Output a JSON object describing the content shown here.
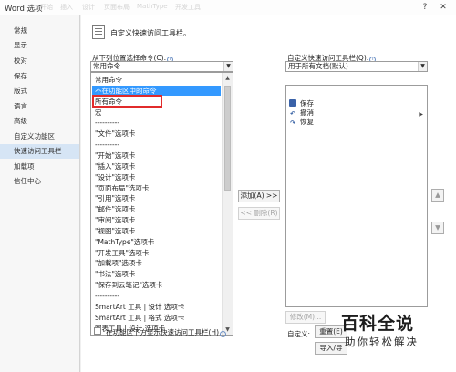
{
  "window": {
    "title": "Word 选项",
    "ghost_tabs": [
      "开始",
      "插入",
      "设计",
      "页面布局",
      "MathType",
      "开发工具"
    ],
    "help_icon": "question-icon",
    "close_icon": "close-icon"
  },
  "sidebar": {
    "items": [
      {
        "label": "常规"
      },
      {
        "label": "显示"
      },
      {
        "label": "校对"
      },
      {
        "label": "保存"
      },
      {
        "label": "版式"
      },
      {
        "label": "语言"
      },
      {
        "label": "高级"
      },
      {
        "label": "自定义功能区"
      },
      {
        "label": "快速访问工具栏",
        "active": true
      },
      {
        "label": "加载项"
      },
      {
        "label": "信任中心"
      }
    ]
  },
  "header": {
    "icon": "customize-toolbar-icon",
    "text": "自定义快速访问工具栏。"
  },
  "left": {
    "choose_label": "从下列位置选择命令(C):",
    "choose_value": "常用命令",
    "list_items": [
      "常用命令",
      "不在功能区中的命令",
      "所有命令",
      "宏",
      "----------",
      "\"文件\"选项卡",
      "----------",
      "\"开始\"选项卡",
      "\"插入\"选项卡",
      "\"设计\"选项卡",
      "\"页面布局\"选项卡",
      "\"引用\"选项卡",
      "\"邮件\"选项卡",
      "\"审阅\"选项卡",
      "\"视图\"选项卡",
      "\"MathType\"选项卡",
      "\"开发工具\"选项卡",
      "\"加载项\"选项卡",
      "\"书法\"选项卡",
      "\"保存到云笔记\"选项卡",
      "----------",
      "SmartArt 工具 | 设计 选项卡",
      "SmartArt 工具 | 格式 选项卡",
      "图表工具 | 设计 选项卡"
    ],
    "selected_index": 1,
    "show_below_label": "在功能区下方显示快速访问工具栏(H)"
  },
  "middle": {
    "add_label": "添加(A) >>",
    "remove_label": "<< 删除(R)"
  },
  "right": {
    "customize_label": "自定义快速访问工具栏(Q):",
    "customize_value": "用于所有文档(默认)",
    "qat_items": [
      {
        "label": "保存",
        "icon": "save-icon"
      },
      {
        "label": "撤消",
        "icon": "undo-icon"
      },
      {
        "label": "恢复",
        "icon": "redo-icon"
      }
    ],
    "modify_label": "修改(M)...",
    "customize_text": "自定义:",
    "reset_label": "重置(E)",
    "import_label": "导入/导"
  },
  "watermark": {
    "main": "百科全说",
    "sub": "助你轻松解决"
  },
  "colors": {
    "selection": "#3399ff",
    "highlight_border": "#e12b2b",
    "sidebar_active": "#d6e5f5"
  }
}
